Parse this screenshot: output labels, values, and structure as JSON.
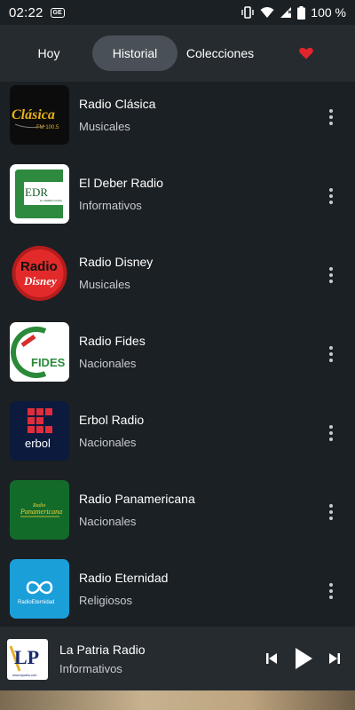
{
  "status_bar": {
    "time": "02:22",
    "badge": "GE",
    "battery": "100 %"
  },
  "tabs": [
    {
      "label": "Hoy"
    },
    {
      "label": "Historial"
    },
    {
      "label": "Colecciones"
    },
    {
      "icon": "heart-icon"
    }
  ],
  "stations": [
    {
      "name": "Radio Clásica",
      "category": "Musicales",
      "logo_text": "Clásica",
      "logo_sub": "FM 100.5"
    },
    {
      "name": "El Deber Radio",
      "category": "Informativos",
      "logo_text": "EDR",
      "logo_sub": "EL DEBER RADIO"
    },
    {
      "name": "Radio Disney",
      "category": "Musicales",
      "logo_text": "Radio",
      "logo_sub": "Disney"
    },
    {
      "name": "Radio Fides",
      "category": "Nacionales",
      "logo_text": "FIDES"
    },
    {
      "name": "Erbol Radio",
      "category": "Nacionales",
      "logo_text": "erbol"
    },
    {
      "name": "Radio Panamericana",
      "category": "Nacionales",
      "logo_text": "Radio",
      "logo_sub": "Panamericana"
    },
    {
      "name": "Radio Eternidad",
      "category": "Religiosos",
      "logo_text": "RadioEternidad"
    }
  ],
  "player": {
    "title": "La Patria Radio",
    "category": "Informativos",
    "logo_text": "LP",
    "logo_sub": "www.lapatria.com"
  },
  "colors": {
    "background": "#1b2024",
    "tab_bar": "#262b30",
    "active_tab": "#4a5057",
    "heart": "#e0262b"
  }
}
